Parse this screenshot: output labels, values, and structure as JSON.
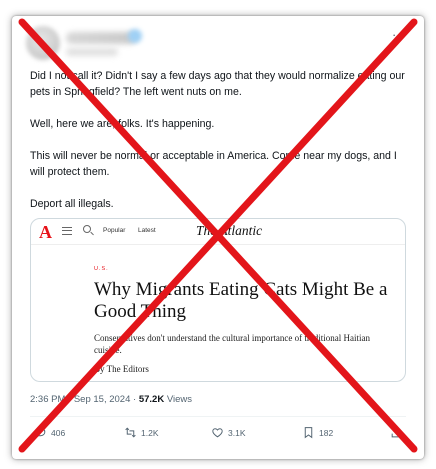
{
  "tweet": {
    "paragraphs": [
      "Did I not call it? Didn't I say a few days ago that they would normalize eating our pets in Springfield? The left went nuts on me.",
      "Well, here we are, folks. It's happening.",
      "This will never be normal or acceptable in America. Come near my dogs, and I will protect them.",
      "Deport all illegals."
    ],
    "more_icon": "···"
  },
  "card": {
    "brand_letter": "A",
    "nav_popular": "Popular",
    "nav_latest": "Latest",
    "logo": "The Atlantic",
    "kicker": "U.S.",
    "title": "Why Migrants Eating Cats Might Be a Good Thing",
    "subtitle": "Conservatives don't understand the cultural importance of traditional Haitian cuisine.",
    "byline": "By The Editors",
    "brand_color": "#e7131a"
  },
  "meta": {
    "time": "2:36 PM",
    "date": "Sep 15, 2024",
    "separator": "·",
    "views_count": "57.2K",
    "views_label": "Views"
  },
  "actions": {
    "replies": "406",
    "retweets": "1.2K",
    "likes": "3.1K",
    "bookmarks": "182"
  },
  "overlay": {
    "type": "red-x-cross",
    "color": "#e3151a"
  }
}
